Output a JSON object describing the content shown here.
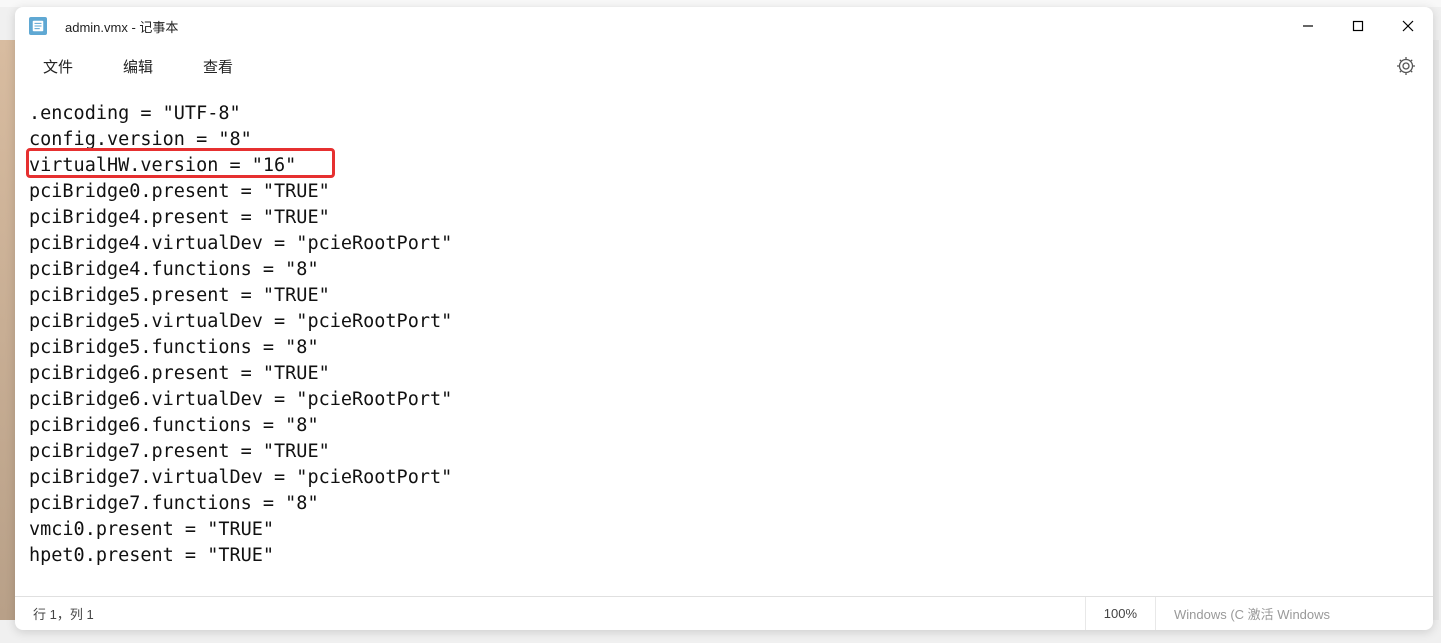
{
  "titlebar": {
    "title": "admin.vmx - 记事本"
  },
  "menubar": {
    "file": "文件",
    "edit": "编辑",
    "view": "查看"
  },
  "content_lines": [
    ".encoding = \"UTF-8\"",
    "config.version = \"8\"",
    "virtualHW.version = \"16\"",
    "pciBridge0.present = \"TRUE\"",
    "pciBridge4.present = \"TRUE\"",
    "pciBridge4.virtualDev = \"pcieRootPort\"",
    "pciBridge4.functions = \"8\"",
    "pciBridge5.present = \"TRUE\"",
    "pciBridge5.virtualDev = \"pcieRootPort\"",
    "pciBridge5.functions = \"8\"",
    "pciBridge6.present = \"TRUE\"",
    "pciBridge6.virtualDev = \"pcieRootPort\"",
    "pciBridge6.functions = \"8\"",
    "pciBridge7.present = \"TRUE\"",
    "pciBridge7.virtualDev = \"pcieRootPort\"",
    "pciBridge7.functions = \"8\"",
    "vmci0.present = \"TRUE\"",
    "hpet0.present = \"TRUE\""
  ],
  "statusbar": {
    "position": "行 1，列 1",
    "zoom": "100%",
    "encoding_info": "Windows (C 激活 Windows"
  },
  "highlighted_line_index": 2
}
